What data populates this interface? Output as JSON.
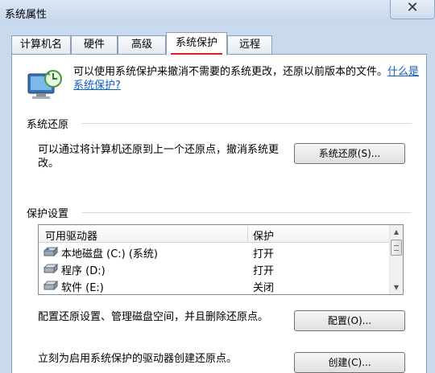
{
  "window": {
    "title": "系统属性",
    "close_glyph": "✕"
  },
  "tabs": [
    {
      "label": "计算机名"
    },
    {
      "label": "硬件"
    },
    {
      "label": "高级"
    },
    {
      "label": "系统保护",
      "active": true
    },
    {
      "label": "远程"
    }
  ],
  "intro": {
    "text": "可以使用系统保护来撤消不需要的系统更改，还原以前版本的文件。",
    "link": "什么是系统保护?"
  },
  "restore": {
    "title": "系统还原",
    "description": "可以通过将计算机还原到上一个还原点，撤消系统更改。",
    "button": "系统还原(S)..."
  },
  "protection": {
    "title": "保护设置",
    "columns": [
      "可用驱动器",
      "保护"
    ],
    "drives": [
      {
        "name": "本地磁盘 (C:) (系统)",
        "state": "打开",
        "icon": "system-drive-icon"
      },
      {
        "name": "程序 (D:)",
        "state": "打开",
        "icon": "hard-drive-icon"
      },
      {
        "name": "软件 (E:)",
        "state": "关闭",
        "icon": "hard-drive-icon"
      }
    ],
    "configure_text": "配置还原设置、管理磁盘空间，并且删除还原点。",
    "configure_button": "配置(O)...",
    "create_text": "立刻为启用系统保护的驱动器创建还原点。",
    "create_button": "创建(C)..."
  },
  "colors": {
    "active_tab_marker": "#e02020",
    "link": "#0f5dc6"
  }
}
